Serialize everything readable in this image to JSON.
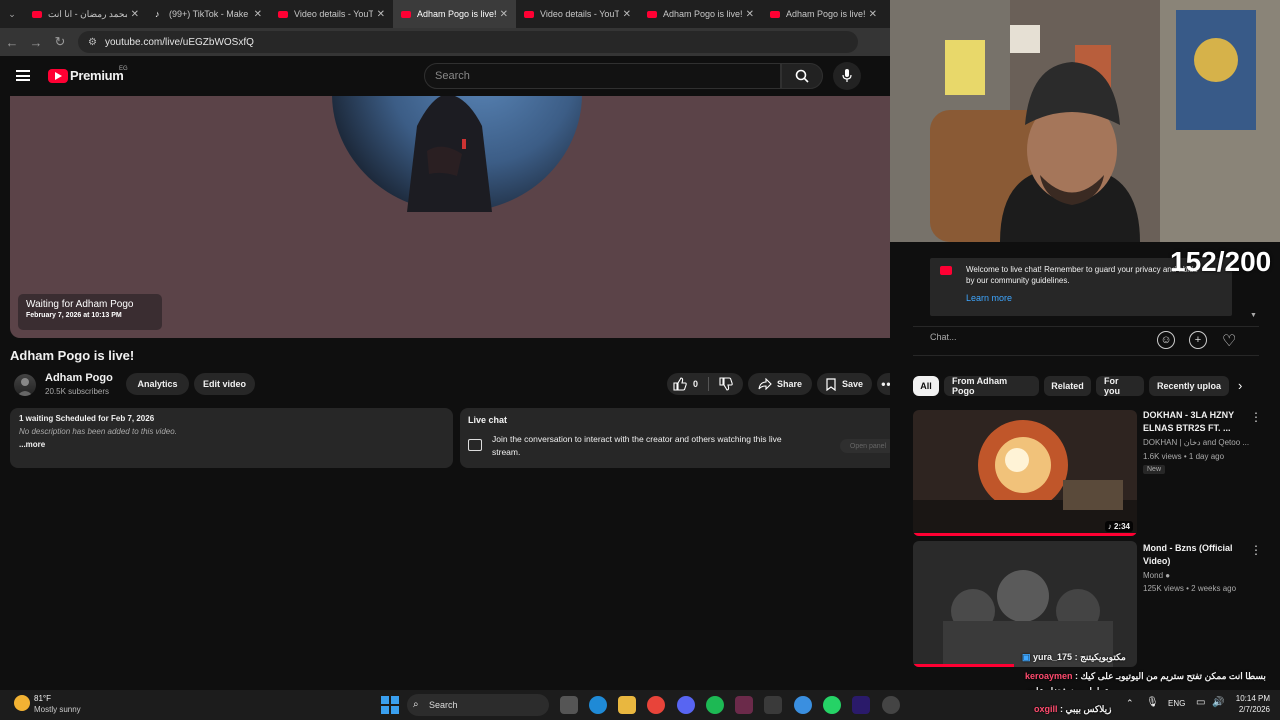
{
  "browser": {
    "tabs": [
      {
        "label": "محمد رمضان - انا انت",
        "icon": "youtube-icon",
        "active": false
      },
      {
        "label": "(99+) TikTok - Make Y",
        "icon": "tiktok-icon",
        "active": false
      },
      {
        "label": "Video details - YouTu",
        "icon": "youtube-icon",
        "active": false
      },
      {
        "label": "Adham Pogo is live!",
        "icon": "youtube-icon",
        "active": true
      },
      {
        "label": "Video details - YouTu",
        "icon": "youtube-icon",
        "active": false
      },
      {
        "label": "Adham Pogo is live!",
        "icon": "youtube-icon",
        "active": false
      },
      {
        "label": "Adham Pogo is live!",
        "icon": "youtube-icon",
        "active": false
      }
    ],
    "url": "youtube.com/live/uEGZbWOSxfQ"
  },
  "header": {
    "logo_text": "Premium",
    "country": "EG",
    "search_placeholder": "Search"
  },
  "player": {
    "waiting_title": "Waiting for Adham Pogo",
    "waiting_date": "February 7, 2026 at 10:13 PM"
  },
  "video": {
    "title": "Adham Pogo is live!",
    "channel_name": "Adham Pogo",
    "subscribers": "20.5K subscribers",
    "analytics_label": "Analytics",
    "edit_label": "Edit video",
    "like_count": "0",
    "share_label": "Share",
    "save_label": "Save"
  },
  "description": {
    "meta": "1 waiting  Scheduled for Feb 7, 2026",
    "text": "No description has been added to this video.",
    "more": "...more"
  },
  "livechat_box": {
    "title": "Live chat",
    "text": "Join the conversation to interact with the creator and others watching this live stream.",
    "open_panel": "Open panel"
  },
  "overlay": {
    "counter": "152/200"
  },
  "chat": {
    "welcome": "Welcome to live chat! Remember to guard your privacy and abide by our community guidelines.",
    "learn_more": "Learn more",
    "input_placeholder": "Chat..."
  },
  "chips": [
    "All",
    "From Adham Pogo",
    "Related",
    "For you",
    "Recently uploa"
  ],
  "recommendations": [
    {
      "title": "DOKHAN - 3LA HZNY ELNAS BTR2S FT. ...",
      "channel": "DOKHAN | دخان and Qetoo ...",
      "meta": "1.6K views • 1 day ago",
      "badge": "New",
      "duration": "2:34",
      "progress": 1.0
    },
    {
      "title": "Mond - Bzns (Official Video)",
      "channel": "Mond",
      "meta": "125K views • 2 weeks ago",
      "progress": 0.45
    }
  ],
  "overlay_chat": [
    {
      "user": "yura_175",
      "message": "مكتوبويكيتنج",
      "user_color": "#ffffff"
    },
    {
      "user": "keroaymen",
      "message": "بسطا انت ممكن تفتح ستريم من اليوتيوبـ على كيك",
      "user_color": "#ff4b6e"
    },
    {
      "user": "",
      "message": "عطول و هيشتغل عادي",
      "user_color": "#ffffff"
    },
    {
      "user": "oxgill",
      "message": "زيلاكس بيبي",
      "user_color": "#ff4b6e"
    }
  ],
  "taskbar": {
    "weather_temp": "81°F",
    "weather_desc": "Mostly sunny",
    "search_label": "Search",
    "language": "ENG",
    "time": "10:14 PM",
    "date": "2/7/2026"
  }
}
